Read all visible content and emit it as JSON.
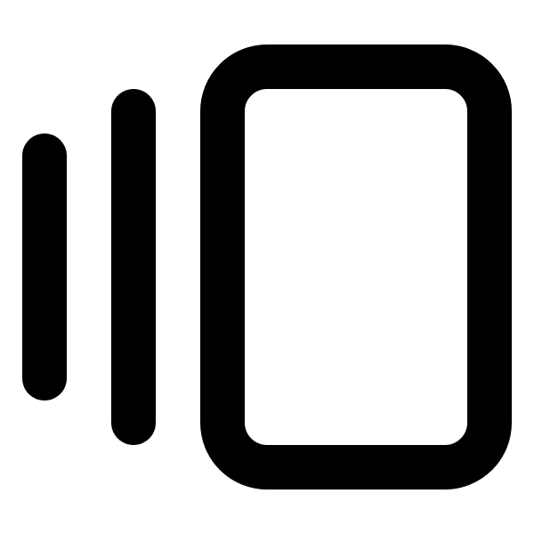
{
  "icon": {
    "name": "stacked-cards-icon",
    "stroke_color": "#000000",
    "background_color": "#ffffff"
  }
}
